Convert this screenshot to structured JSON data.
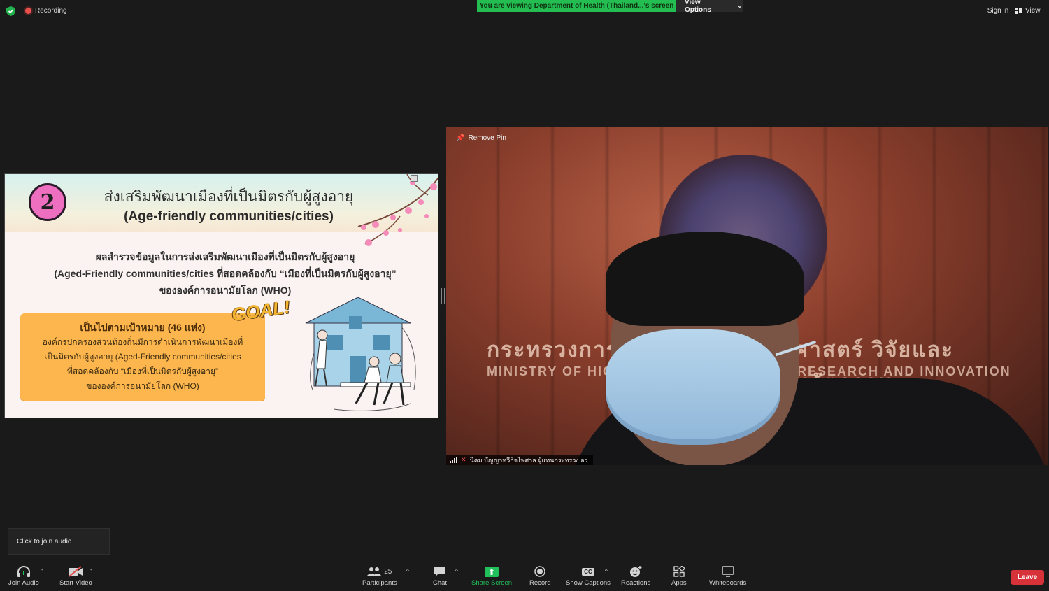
{
  "topbar": {
    "recording_label": "Recording",
    "viewing_banner": "You are viewing Department of Health (Thailand...'s screen",
    "view_options_label": "View Options",
    "sign_in_label": "Sign in",
    "view_label": "View"
  },
  "slide": {
    "badge_number": "2",
    "title_th": "ส่งเสริมพัฒนาเมืองที่เป็นมิตรกับผู้สูงอายุ",
    "title_en": "(Age-friendly communities/cities)",
    "body_line1": "ผลสำรวจข้อมูลในการส่งเสริมพัฒนาเมืองที่เป็นมิตรกับผู้สูงอายุ",
    "body_line2": "(Aged-Friendly communities/cities ที่สอดคล้องกับ “เมืองที่เป็นมิตรกับผู้สูงอายุ”",
    "body_line3": "ขององค์การอนามัยโลก (WHO)",
    "goal_label": "GOAL!",
    "goalbox_line1": "เป็นไปตามเป้าหมาย (46 แห่ง)",
    "goalbox_line2": "องค์กรปกครองส่วนท้องถิ่นมีการดำเนินการพัฒนาเมืองที่",
    "goalbox_line3": "เป็นมิตรกับผู้สูงอายุ (Aged-Friendly communities/cities",
    "goalbox_line4": "ที่สอดคล้องกับ “เมืองที่เป็นมิตรกับผู้สูงอายุ”",
    "goalbox_line5": "ขององค์การอนามัยโลก (WHO)"
  },
  "video": {
    "remove_pin_label": "Remove Pin",
    "participant_name": "นิคม บัญญาหวีกิจไพศาล ผู้แทนกระทรวง อว.",
    "wall_text_th_left": "กระทรวงการอ",
    "wall_text_th_right": "ศาสตร์ วิจัยและนวัตกรรม",
    "wall_text_en_left": "MINISTRY OF HIGH",
    "wall_text_en_right": "RESEARCH AND INNOVATION"
  },
  "toast": {
    "text": "Click to join audio"
  },
  "toolbar": {
    "join_audio": "Join Audio",
    "start_video": "Start Video",
    "participants": "Participants",
    "participants_count": "25",
    "chat": "Chat",
    "share_screen": "Share Screen",
    "record": "Record",
    "show_captions": "Show Captions",
    "captions_badge": "CC",
    "reactions": "Reactions",
    "apps": "Apps",
    "whiteboards": "Whiteboards",
    "leave": "Leave"
  },
  "colors": {
    "accent_green": "#23bd52",
    "leave_red": "#d7323a",
    "goal_orange": "#fdb64d",
    "badge_pink": "#ee6fc0"
  }
}
